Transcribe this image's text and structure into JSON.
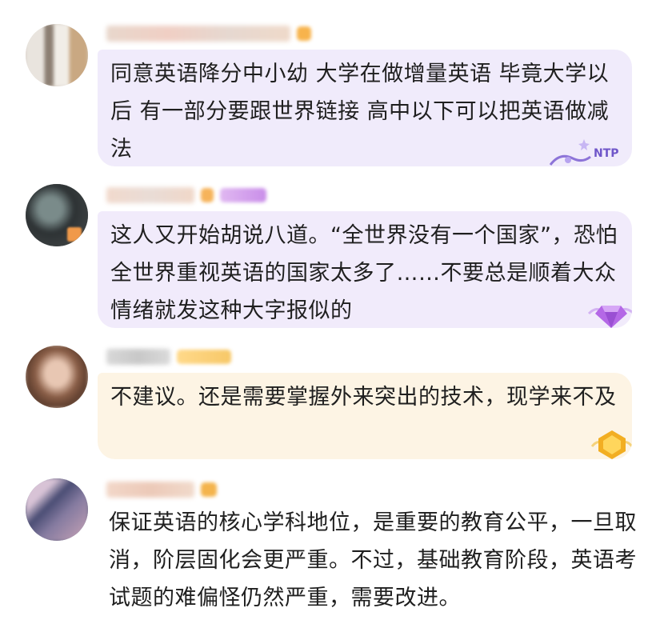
{
  "comments": [
    {
      "text": "同意英语降分中小幼  大学在做增量英语  毕竟大学以后  有一部分要跟世界链接  高中以下可以把英语做减法",
      "decoration_icon": "ntp-sticker-icon"
    },
    {
      "text": "这人又开始胡说八道。“全世界没有一个国家”，恐怕全世界重视英语的国家太多了……不要总是顺着大众情绪就发这种大字报似的",
      "decoration_icon": "purple-gem-icon"
    },
    {
      "text": "不建议。还是需要掌握外来突出的技术，现学来不及",
      "decoration_icon": "gold-gem-icon"
    },
    {
      "text": "保证英语的核心学科地位，是重要的教育公平，一旦取消，阶层固化会更严重。不过，基础教育阶段，英语考试题的难偏怪仍然严重，需要改进。"
    }
  ],
  "colors": {
    "bubble_lavender": "#efe9fb",
    "bubble_peach": "#fdf3e3",
    "text": "#1f1f1f"
  }
}
